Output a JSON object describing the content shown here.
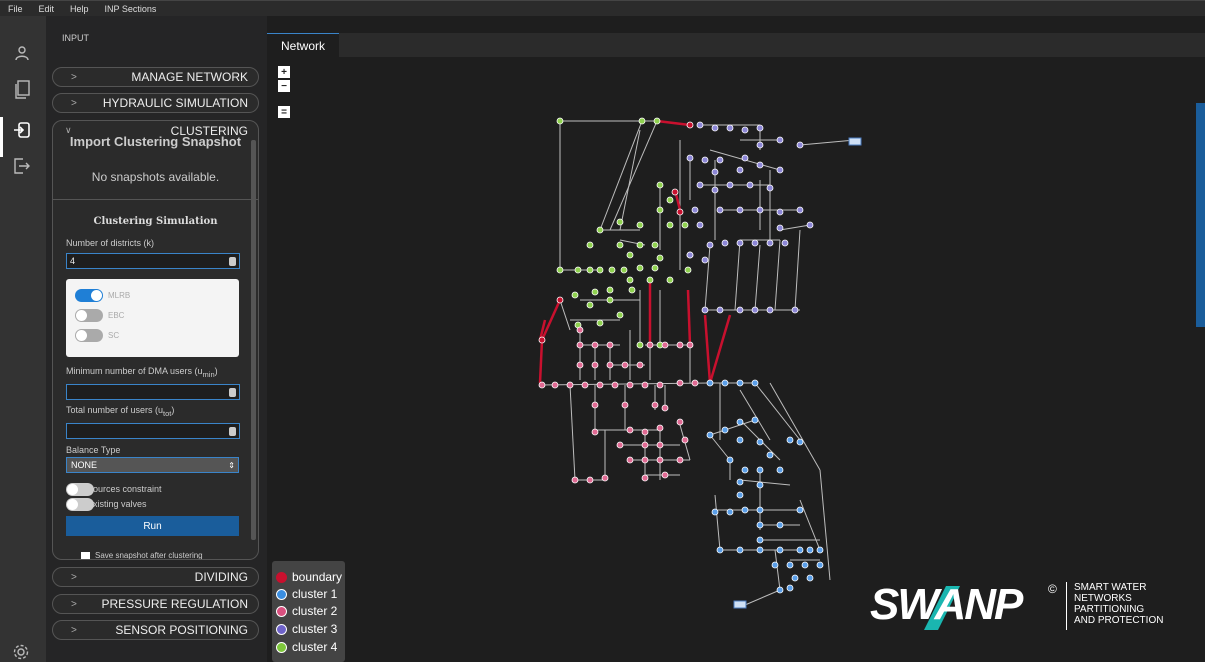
{
  "menubar": [
    "File",
    "Edit",
    "Help",
    "INP Sections"
  ],
  "panel": {
    "title": "INPUT",
    "sections": {
      "manage_network": "MANAGE NETWORK",
      "hydraulic_simulation": "HYDRAULIC SIMULATION",
      "clustering": "CLUSTERING",
      "dividing": "DIVIDING",
      "pressure_regulation": "PRESSURE REGULATION",
      "sensor_positioning": "SENSOR POSITIONING"
    },
    "chevron_right": ">",
    "chevron_down": "∨",
    "clustering": {
      "snapshot_title": "Import Clustering Snapshot",
      "no_snapshots": "No snapshots available.",
      "sim_title": "Clustering Simulation",
      "districts_label": "Number of districts (k)",
      "districts_value": "4",
      "methods": [
        {
          "label": "MLRB",
          "on": true
        },
        {
          "label": "EBC",
          "on": false
        },
        {
          "label": "SC",
          "on": false
        }
      ],
      "min_users_label": "Minimum number of DMA users (u",
      "min_users_sub": "min",
      "min_users_close": ")",
      "total_users_label": "Total number of users (u",
      "total_users_sub": "tot",
      "total_users_close": ")",
      "balance_label": "Balance Type",
      "balance_value": "NONE",
      "sources_constraint": "Sources constraint",
      "existing_valves": "Existing valves",
      "run": "Run",
      "save_snapshot": "Save snapshot after clustering"
    }
  },
  "tab": "Network",
  "zoom": {
    "plus": "+",
    "minus": "−",
    "fit": "="
  },
  "legend": [
    {
      "label": "boundary",
      "color": "#c8102e"
    },
    {
      "label": "cluster 1",
      "color": "#3b8ee0"
    },
    {
      "label": "cluster 2",
      "color": "#d9507f"
    },
    {
      "label": "cluster 3",
      "color": "#6f63c9"
    },
    {
      "label": "cluster 4",
      "color": "#7ec73c"
    }
  ],
  "logo": {
    "word": "SWANP",
    "reg": "©",
    "tag": [
      "SMART WATER",
      "NETWORKS",
      "PARTITIONING",
      "AND PROTECTION"
    ]
  },
  "colors": {
    "boundary": "#c8102e",
    "cluster1": "#5a9ee8",
    "cluster2": "#e06a93",
    "cluster3": "#8c86d6",
    "cluster4": "#8fd14f",
    "accent": "#1a5d9b"
  }
}
